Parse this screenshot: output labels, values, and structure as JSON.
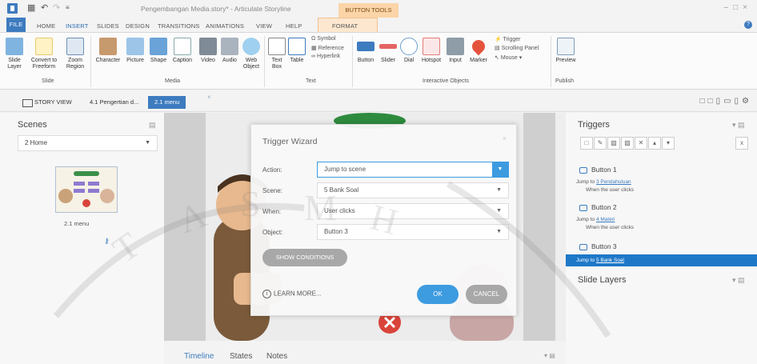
{
  "titlebar": {
    "title": "Pengembangan Media.story* - Articulate Storyline",
    "context_tab": "BUTTON TOOLS"
  },
  "ribbon_tabs": [
    "FILE",
    "HOME",
    "INSERT",
    "SLIDES",
    "DESIGN",
    "TRANSITIONS",
    "ANIMATIONS",
    "VIEW",
    "HELP",
    "FORMAT"
  ],
  "ribbon": {
    "slide_group": {
      "label": "Slide",
      "items": [
        "Slide Layer",
        "Convert to Freeform",
        "Zoom Region"
      ]
    },
    "media_group": {
      "label": "Media",
      "items": [
        "Character",
        "Picture",
        "Shape",
        "Caption",
        "Video",
        "Audio",
        "Web Object"
      ]
    },
    "text_group": {
      "label": "Text",
      "items": [
        "Text Box",
        "Table"
      ],
      "small_items": [
        "Symbol",
        "Reference",
        "Hyperlink"
      ]
    },
    "interactive_group": {
      "label": "Interactive Objects",
      "items": [
        "Button",
        "Slider",
        "Dial",
        "Hotspot",
        "Input",
        "Marker"
      ],
      "small_items": [
        "Trigger",
        "Scrolling Panel",
        "Mouse"
      ]
    },
    "publish_group": {
      "label": "Publish",
      "items": [
        "Preview"
      ]
    }
  },
  "viewbar": {
    "story_view": "STORY VIEW",
    "tab1": "4.1 Pengertian d...",
    "tab2": "2.1 menu"
  },
  "scenes": {
    "title": "Scenes",
    "dropdown": "2 Home",
    "thumb_label": "2.1 menu"
  },
  "bottom_tabs": [
    "Timeline",
    "States",
    "Notes"
  ],
  "dialog": {
    "title": "Trigger Wizard",
    "labels": {
      "action": "Action:",
      "scene": "Scene:",
      "when": "When:",
      "object": "Object:"
    },
    "values": {
      "action": "Jump to scene",
      "scene": "5 Bank Soal",
      "when": "User clicks",
      "object": "Button 3"
    },
    "show_conditions": "SHOW CONDITIONS",
    "learn_more": "LEARN MORE...",
    "ok": "OK",
    "cancel": "CANCEL"
  },
  "triggers": {
    "title": "Triggers",
    "items": [
      {
        "name": "Button 1",
        "action_prefix": "Jump to ",
        "target": "3 Pendahuluan",
        "condition": "When the user clicks"
      },
      {
        "name": "Button 2",
        "action_prefix": "Jump to ",
        "target": "4 Materi",
        "condition": "When the user clicks"
      },
      {
        "name": "Button 3",
        "action_prefix": "Jump to ",
        "target": "5 Bank Soal"
      }
    ],
    "slide_layers": "Slide Layers"
  },
  "colors": {
    "accent": "#3d7bbf",
    "button_blue": "#3d9be0",
    "selected_row": "#1e78c8",
    "context_tab": "#fbd4a8"
  }
}
